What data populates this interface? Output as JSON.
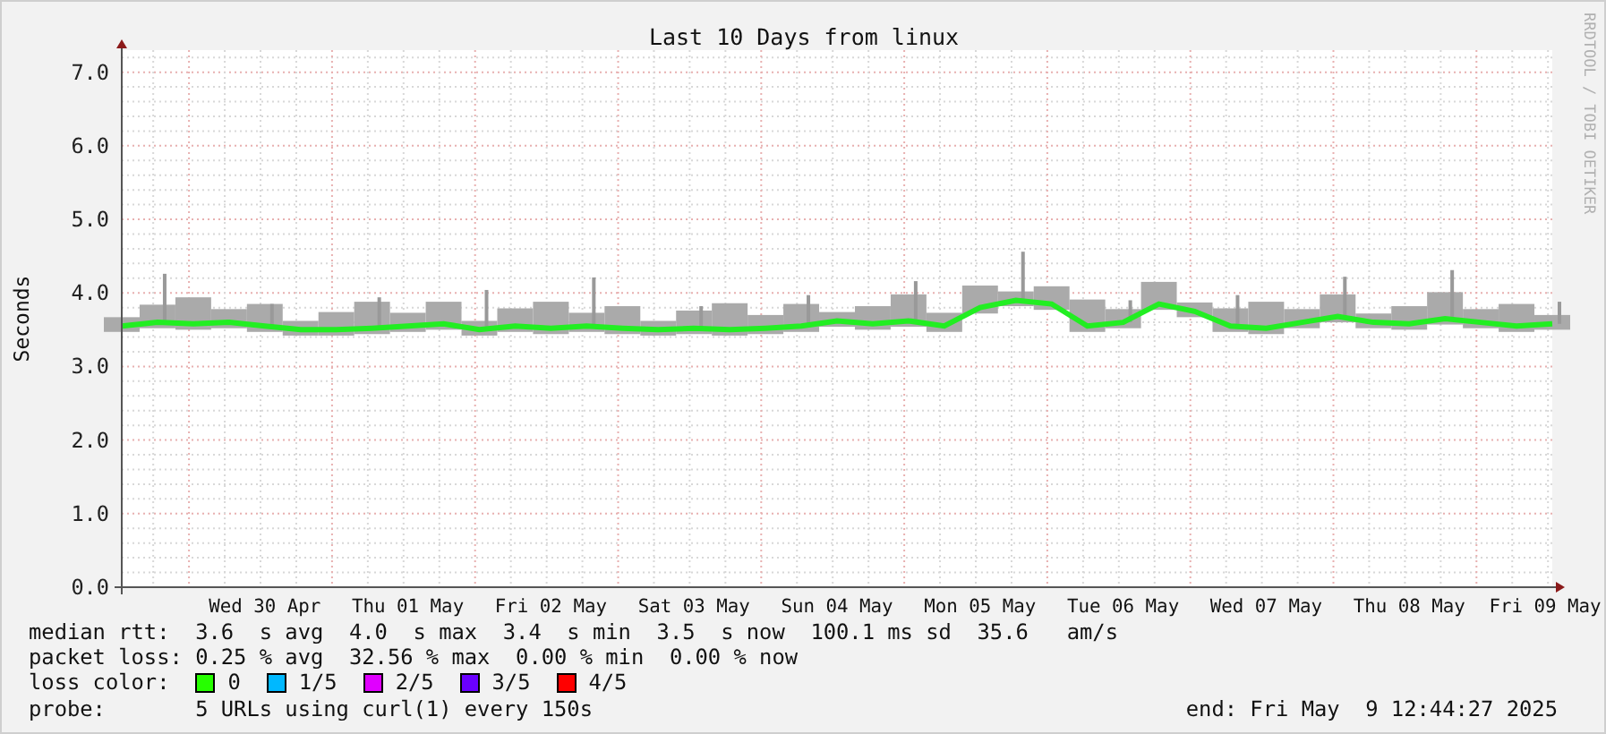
{
  "chart": {
    "credit": "RRDTOOL / TOBI OETIKER",
    "chart_data": {
      "type": "line",
      "grid": true,
      "title": "Last 10 Days from linux",
      "ylabel": "Seconds",
      "ylim": [
        0,
        7.3
      ],
      "categories": [
        null,
        null,
        null,
        null,
        "Wed 30 Apr",
        null,
        null,
        null,
        "Thu 01 May",
        null,
        null,
        null,
        "Fri 02 May",
        null,
        null,
        null,
        "Sat 03 May",
        null,
        null,
        null,
        "Sun 04 May",
        null,
        null,
        null,
        "Mon 05 May",
        null,
        null,
        null,
        "Tue 06 May",
        null,
        null,
        null,
        "Wed 07 May",
        null,
        null,
        null,
        "Thu 08 May",
        null,
        null,
        null,
        "Fri 09 May"
      ],
      "series": [
        {
          "color": "#22ee22",
          "values": [
            3.55,
            3.6,
            3.58,
            3.6,
            3.55,
            3.5,
            3.5,
            3.52,
            3.55,
            3.58,
            3.5,
            3.55,
            3.52,
            3.55,
            3.52,
            3.5,
            3.52,
            3.5,
            3.52,
            3.55,
            3.62,
            3.58,
            3.62,
            3.55,
            3.8,
            3.9,
            3.85,
            3.55,
            3.6,
            3.85,
            3.75,
            3.55,
            3.52,
            3.6,
            3.68,
            3.6,
            3.58,
            3.65,
            3.6,
            3.55,
            3.58
          ]
        }
      ],
      "yticks": [
        {
          "value": 0,
          "label": "0.0"
        },
        {
          "value": 1,
          "label": "1.0"
        },
        {
          "value": 2,
          "label": "2.0"
        },
        {
          "value": 3,
          "label": "3.0"
        },
        {
          "value": 4,
          "label": "4.0"
        },
        {
          "value": 5,
          "label": "5.0"
        },
        {
          "value": 6,
          "label": "6.0"
        },
        {
          "value": 7,
          "label": "7.0"
        }
      ]
    }
  },
  "legend": [
    {
      "kind": "values",
      "label": "median rtt:",
      "items": [
        "3.6  s avg",
        "4.0  s max",
        "3.4  s min",
        "3.5  s now",
        "100.1 ms sd",
        "35.6   am/s"
      ]
    },
    {
      "kind": "values",
      "label": "packet loss:",
      "items": [
        "0.25 % avg",
        "32.56 % max",
        "0.00 % min",
        "0.00 % now"
      ]
    },
    {
      "kind": "swatches",
      "label": "loss color:",
      "items": [
        {
          "label": "0",
          "color": "#26ff00"
        },
        {
          "label": "1/5",
          "color": "#00b8ff"
        },
        {
          "label": "2/5",
          "color": "#e000ff"
        },
        {
          "label": "3/5",
          "color": "#6a00ff"
        },
        {
          "label": "4/5",
          "color": "#ff0000"
        }
      ]
    },
    {
      "kind": "probe",
      "label": "probe:",
      "text": "5 URLs using curl(1) every 150s",
      "end": "end: Fri May  9 12:44:27 2025"
    }
  ]
}
